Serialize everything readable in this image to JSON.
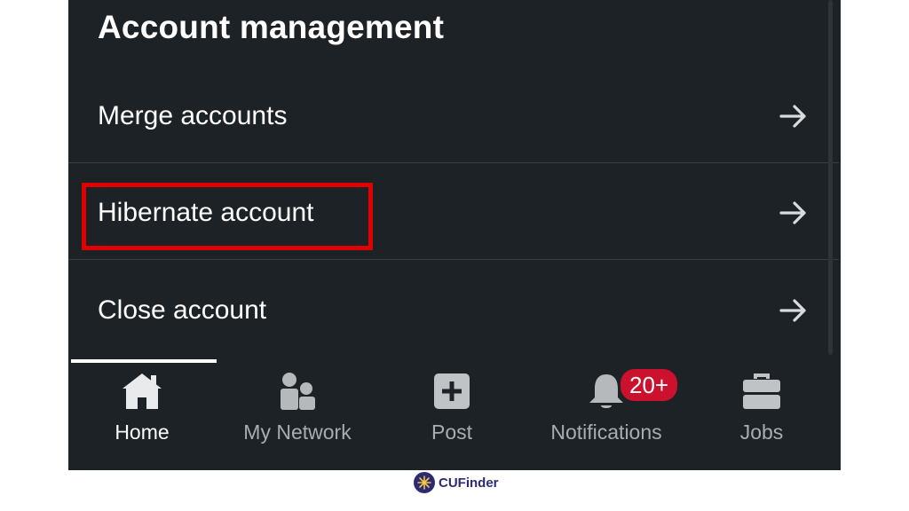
{
  "section": {
    "title": "Account management"
  },
  "rows": [
    {
      "label": "Merge accounts"
    },
    {
      "label": "Hibernate account"
    },
    {
      "label": "Close account"
    }
  ],
  "nav": {
    "items": [
      {
        "label": "Home",
        "icon": "home-icon",
        "active": true
      },
      {
        "label": "My Network",
        "icon": "network-icon"
      },
      {
        "label": "Post",
        "icon": "post-icon"
      },
      {
        "label": "Notifications",
        "icon": "bell-icon"
      },
      {
        "label": "Jobs",
        "icon": "briefcase-icon"
      }
    ],
    "notifications_badge": "20+"
  },
  "brand": {
    "name": "CUFinder"
  },
  "colors": {
    "background": "#1d2226",
    "highlight": "#e00000",
    "badge": "#cb112d",
    "brand": "#2b2a72"
  }
}
